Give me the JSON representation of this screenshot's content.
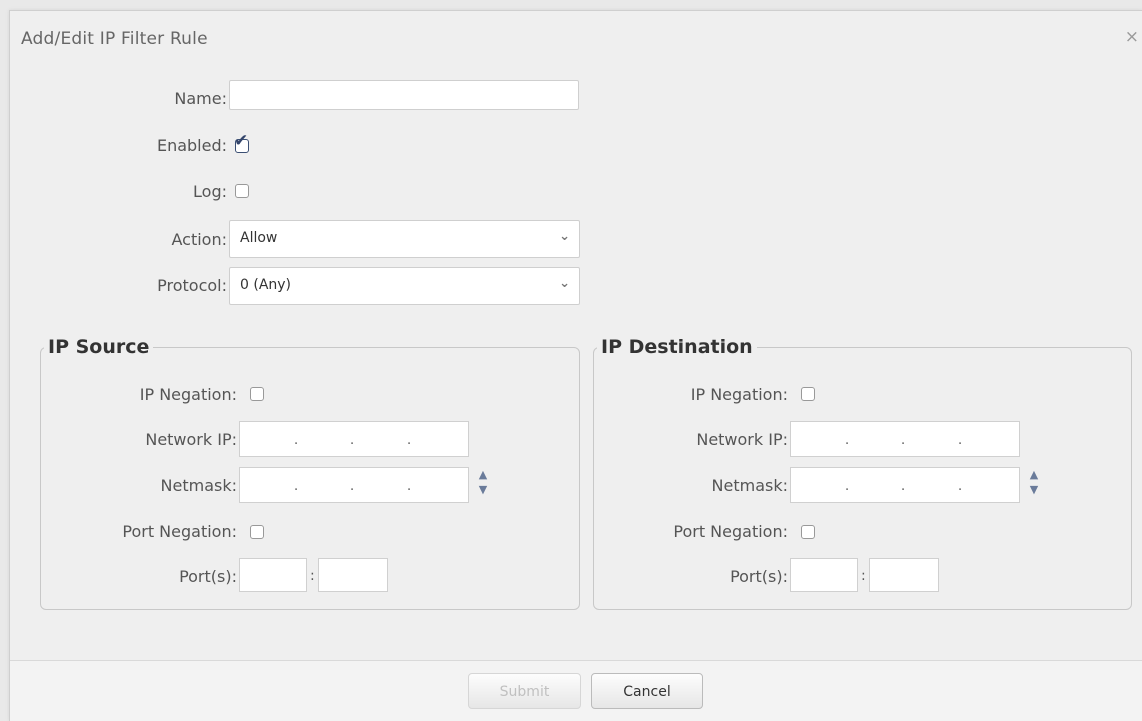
{
  "dialog": {
    "title": "Add/Edit IP Filter Rule",
    "close_glyph": "×"
  },
  "form": {
    "name_label": "Name:",
    "name_value": "",
    "enabled_label": "Enabled:",
    "enabled_checked": true,
    "log_label": "Log:",
    "log_checked": false,
    "action_label": "Action:",
    "action_value": "Allow",
    "protocol_label": "Protocol:",
    "protocol_value": "0 (Any)"
  },
  "source": {
    "legend": "IP Source",
    "ip_negation_label": "IP Negation:",
    "network_ip_label": "Network IP:",
    "netmask_label": "Netmask:",
    "port_negation_label": "Port Negation:",
    "ports_label": "Port(s):",
    "port_separator": ":"
  },
  "destination": {
    "legend": "IP Destination",
    "ip_negation_label": "IP Negation:",
    "network_ip_label": "Network IP:",
    "netmask_label": "Netmask:",
    "port_negation_label": "Port Negation:",
    "ports_label": "Port(s):",
    "port_separator": ":"
  },
  "icons": {
    "dropdown": "chevron-down-icon",
    "spinner_up": "chevron-up-icon",
    "spinner_down": "chevron-down-icon",
    "checkmark": "checkmark-icon",
    "close": "close-icon"
  },
  "buttons": {
    "submit": "Submit",
    "cancel": "Cancel"
  }
}
